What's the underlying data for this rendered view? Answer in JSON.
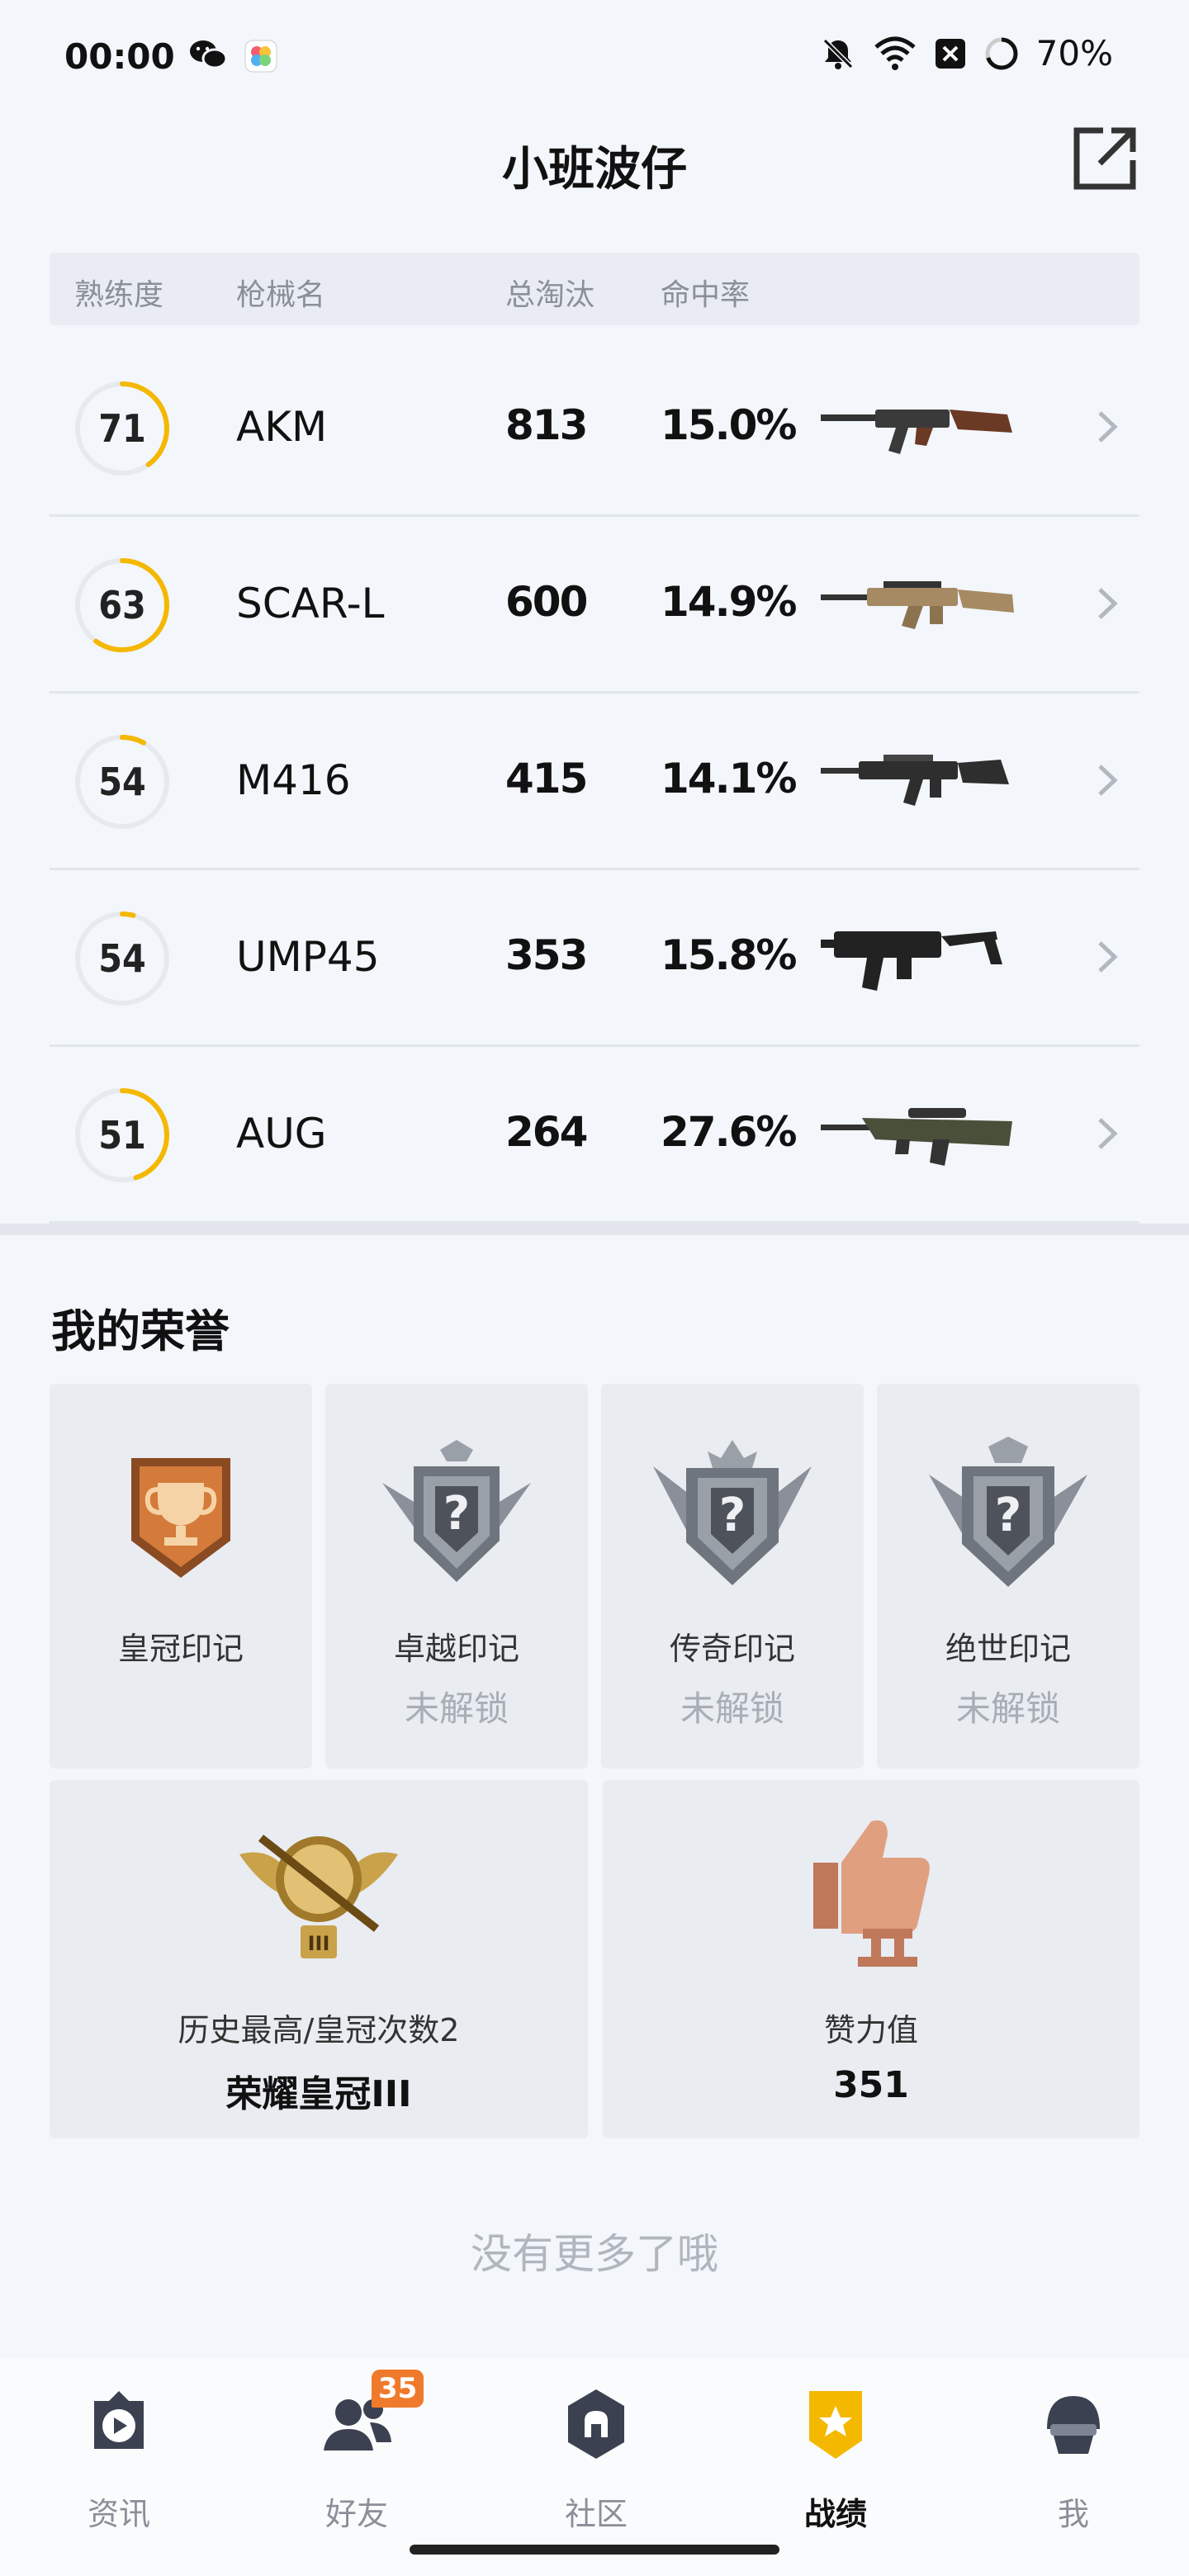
{
  "status_bar": {
    "time": "00:00",
    "battery": "70%",
    "icons": [
      "wechat-icon",
      "app-icon",
      "mute-icon",
      "wifi-icon",
      "sim-off-icon",
      "battery-ring-icon"
    ]
  },
  "header": {
    "title": "小班波仔",
    "share_icon": "share-external-icon"
  },
  "table": {
    "columns": [
      "熟练度",
      "枪械名",
      "总淘汰",
      "命中率"
    ],
    "rows": [
      {
        "mastery": "71",
        "mastery_level": 0.4,
        "name": "AKM",
        "kills": "813",
        "accuracy": "15.0%",
        "gun_icon": "akm-rifle"
      },
      {
        "mastery": "63",
        "mastery_level": 0.6,
        "name": "SCAR-L",
        "kills": "600",
        "accuracy": "14.9%",
        "gun_icon": "scar-l-rifle"
      },
      {
        "mastery": "54",
        "mastery_level": 0.08,
        "name": "M416",
        "kills": "415",
        "accuracy": "14.1%",
        "gun_icon": "m416-rifle"
      },
      {
        "mastery": "54",
        "mastery_level": 0.04,
        "name": "UMP45",
        "kills": "353",
        "accuracy": "15.8%",
        "gun_icon": "ump45-smg"
      },
      {
        "mastery": "51",
        "mastery_level": 0.45,
        "name": "AUG",
        "kills": "264",
        "accuracy": "27.6%",
        "gun_icon": "aug-rifle"
      }
    ]
  },
  "honors": {
    "title": "我的荣誉",
    "badges": [
      {
        "label": "皇冠印记",
        "status": ""
      },
      {
        "label": "卓越印记",
        "status": "未解锁"
      },
      {
        "label": "传奇印记",
        "status": "未解锁"
      },
      {
        "label": "绝世印记",
        "status": "未解锁"
      }
    ],
    "best": {
      "label": "历史最高/皇冠次数2",
      "value": "荣耀皇冠III"
    },
    "likes": {
      "label": "赞力值",
      "value": "351"
    }
  },
  "footer_text": "没有更多了哦",
  "colors": {
    "accent": "#f5b800",
    "ring_track": "#e6e9ee"
  },
  "nav": {
    "items": [
      {
        "label": "资讯",
        "icon": "news-icon"
      },
      {
        "label": "好友",
        "icon": "friends-icon",
        "badge": "35"
      },
      {
        "label": "社区",
        "icon": "community-icon"
      },
      {
        "label": "战绩",
        "icon": "record-icon",
        "active": true
      },
      {
        "label": "我",
        "icon": "profile-icon"
      }
    ]
  }
}
